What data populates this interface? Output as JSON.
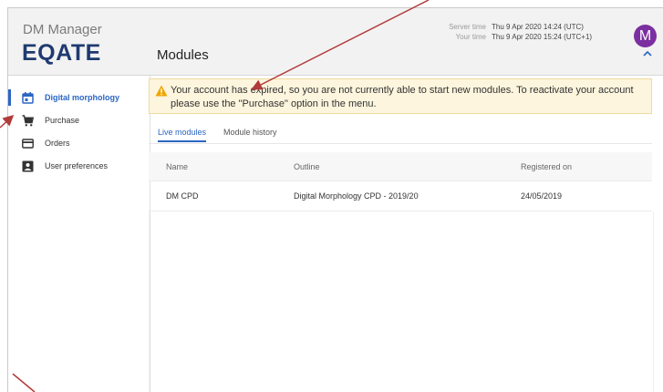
{
  "app": {
    "name": "DM Manager",
    "logo": "EQATE",
    "page_title": "Modules"
  },
  "header": {
    "server_time_label": "Server time",
    "server_time_value": "Thu 9 Apr 2020 14:24 (UTC)",
    "your_time_label": "Your time",
    "your_time_value": "Thu 9 Apr 2020 15:24 (UTC+1)",
    "avatar_letter": "M",
    "avatar_color": "#7b2fa1"
  },
  "sidebar": {
    "items": [
      {
        "label": "Digital morphology",
        "icon": "calendar-icon",
        "active": true
      },
      {
        "label": "Purchase",
        "icon": "cart-icon",
        "active": false
      },
      {
        "label": "Orders",
        "icon": "card-icon",
        "active": false
      },
      {
        "label": "User preferences",
        "icon": "account-box-icon",
        "active": false
      }
    ]
  },
  "alert": {
    "message": "Your account has expired, so you are not currently able to start new modules. To reactivate your account please use the \"Purchase\" option in the menu.",
    "icon": "warning-icon"
  },
  "tabs": [
    {
      "label": "Live modules",
      "active": true
    },
    {
      "label": "Module history",
      "active": false
    }
  ],
  "table": {
    "columns": [
      "Name",
      "Outline",
      "Registered on"
    ],
    "rows": [
      [
        "DM CPD",
        "Digital Morphology CPD - 2019/20",
        "24/05/2019"
      ]
    ]
  },
  "colors": {
    "accent": "#2b66c2",
    "logo": "#1f3a70",
    "alert_bg": "#fdf5dd",
    "annotation_arrow": "#b23a3a"
  }
}
